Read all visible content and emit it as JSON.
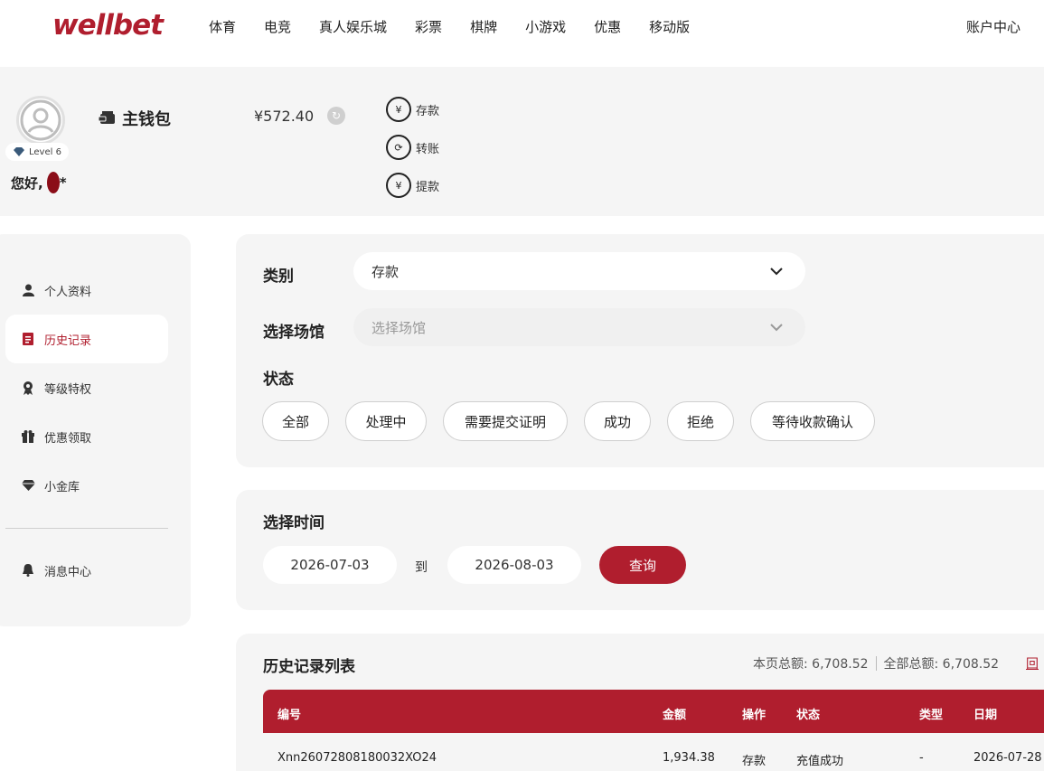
{
  "brand": {
    "logo_text": "wellbet",
    "accent": "#b01e2e"
  },
  "nav": {
    "items": [
      "体育",
      "电竞",
      "真人娱乐城",
      "彩票",
      "棋牌",
      "小游戏",
      "优惠",
      "移动版"
    ],
    "account_center": "账户中心"
  },
  "wallet": {
    "level": "Level 6",
    "greeting": "您好,",
    "greeting_suffix": "*",
    "title": "主钱包",
    "balance": "¥572.40",
    "actions": [
      {
        "label": "存款",
        "icon": "deposit-icon"
      },
      {
        "label": "转账",
        "icon": "transfer-icon"
      },
      {
        "label": "提款",
        "icon": "withdraw-icon"
      }
    ]
  },
  "sidebar": {
    "items": [
      {
        "label": "个人资料",
        "icon": "user-icon"
      },
      {
        "label": "历史记录",
        "icon": "history-icon",
        "active": true
      },
      {
        "label": "等级特权",
        "icon": "medal-icon"
      },
      {
        "label": "优惠领取",
        "icon": "gift-icon"
      },
      {
        "label": "小金库",
        "icon": "diamond-icon"
      },
      {
        "label": "消息中心",
        "icon": "bell-icon"
      }
    ]
  },
  "filters": {
    "category_label": "类别",
    "category_value": "存款",
    "venue_label": "选择场馆",
    "venue_placeholder": "选择场馆",
    "status_label": "状态",
    "status_options": [
      "全部",
      "处理中",
      "需要提交证明",
      "成功",
      "拒绝",
      "等待收款确认"
    ]
  },
  "time": {
    "label": "选择时间",
    "start": "2026-07-03",
    "to": "到",
    "end": "2026-08-03",
    "query": "查询"
  },
  "history": {
    "title": "历史记录列表",
    "page_total": "本页总额: 6,708.52",
    "all_total": "全部总额: 6,708.52",
    "link": "回​",
    "columns": [
      "编号",
      "金额",
      "操作",
      "状态",
      "类型",
      "日期"
    ],
    "rows": [
      [
        "Xnn26072808180032XO24",
        "1,934.38",
        "存款",
        "充值成功",
        "-",
        "2026-07-28"
      ]
    ]
  }
}
